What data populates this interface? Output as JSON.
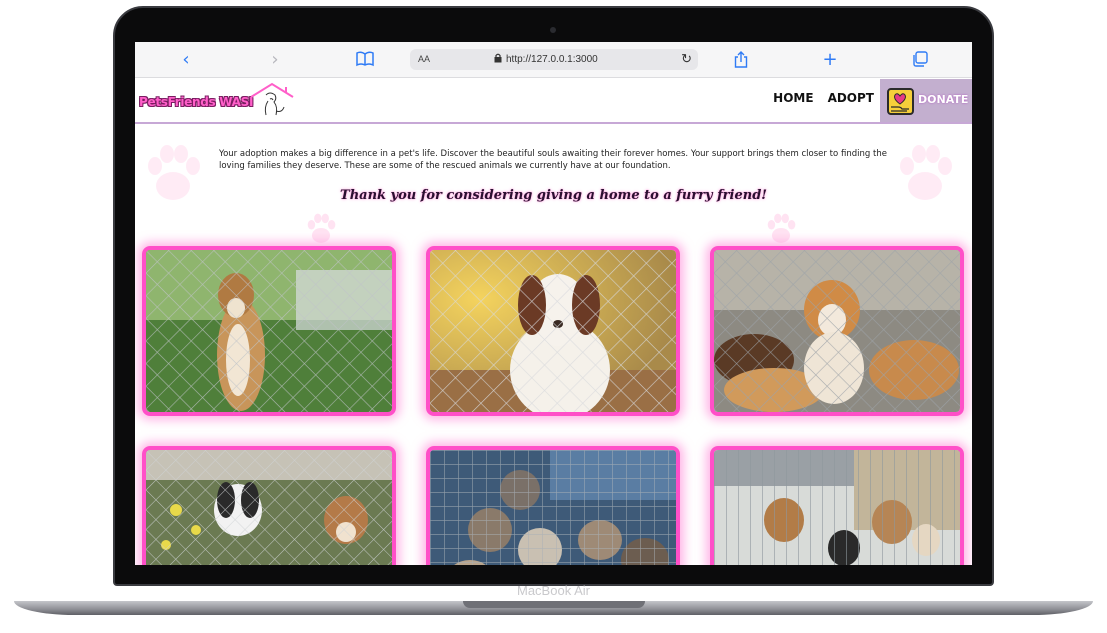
{
  "device": {
    "label": "MacBook Air"
  },
  "browser": {
    "reader_label": "AA",
    "url": "http://127.0.0.1:3000"
  },
  "site": {
    "logo_text": "PetsFriends WASI",
    "nav": [
      "HOME",
      "ADOPT"
    ],
    "donate_label": "DONATE",
    "intro": "Your adoption makes a big difference in a pet's life. Discover the beautiful souls awaiting their forever homes. Your support brings them closer to finding the loving families they deserve. These are some of the rescued animals we currently have at our foundation.",
    "thanks": "Thank you for considering giving a home to a furry friend!"
  },
  "colors": {
    "accent_pink": "#ff4fc8",
    "nav_purple": "#c3afcf",
    "browser_blue": "#2f7bf5"
  },
  "icons": [
    "back-icon",
    "forward-icon",
    "bookmarks-icon",
    "lock-icon",
    "reload-icon",
    "share-icon",
    "new-tab-icon",
    "tabs-icon",
    "house-dog-icon",
    "heart-hand-icon",
    "paw-icon"
  ],
  "gallery": [
    {
      "subject": "dog standing at fence"
    },
    {
      "subject": "puppy behind fence"
    },
    {
      "subject": "dogs in enclosure"
    },
    {
      "subject": "dogs behind fence"
    },
    {
      "subject": "kittens in cage"
    },
    {
      "subject": "dogs in kennel"
    }
  ]
}
